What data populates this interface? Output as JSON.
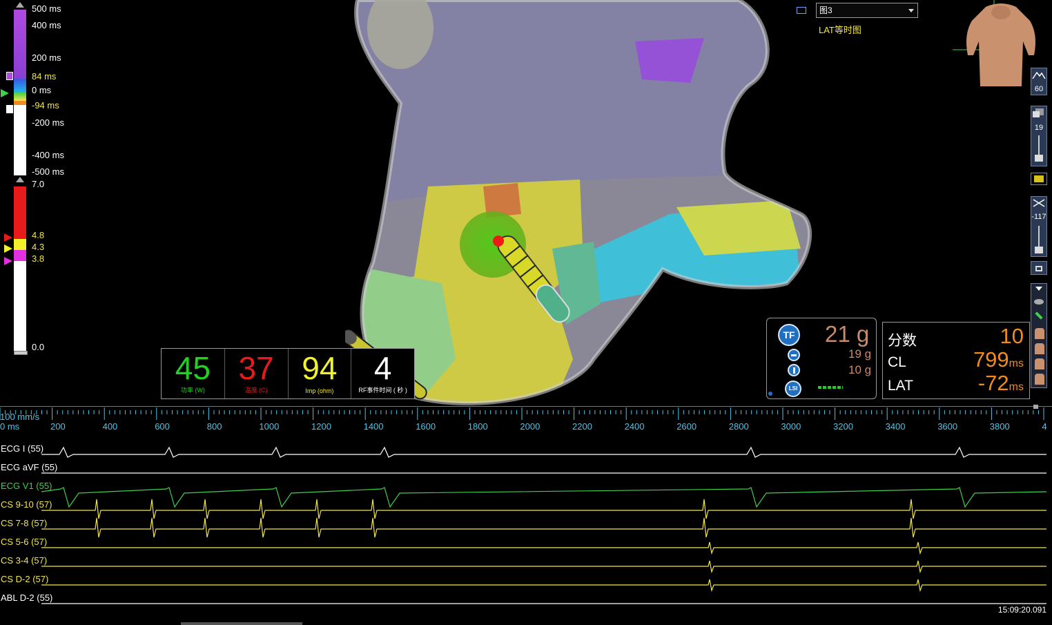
{
  "lat_scale": {
    "labels": [
      "500 ms",
      "400 ms",
      "200 ms",
      "84 ms",
      "0 ms",
      "-94 ms",
      "-200 ms",
      "-400 ms",
      "-500 ms"
    ]
  },
  "voltage_scale": {
    "labels": [
      "7.0",
      "4.8",
      "4.3",
      "3.8",
      "0.0"
    ]
  },
  "view": {
    "selected": "图3",
    "map_name": "LAT等时图"
  },
  "tools": {
    "zoom_value": "60",
    "opacity_value": "19",
    "clip_value": "-117"
  },
  "rf": {
    "power": {
      "value": "45",
      "label": "功率 (W)",
      "color": "#22d022"
    },
    "temperature": {
      "value": "37",
      "label": "温度 (C)",
      "color": "#e81a1a"
    },
    "impedance": {
      "value": "94",
      "label": "Imp (ohm)",
      "color": "#f2f22a"
    },
    "rf_time": {
      "value": "4",
      "label": "RF事件时间 ( 秒 )",
      "color": "#ffffff"
    }
  },
  "force": {
    "tf_badge": "TF",
    "lsi_badge": "LSI",
    "total": "21 g",
    "lateral": "19 g",
    "axial": "10 g"
  },
  "stats": {
    "score_label": "分数",
    "score_value": "10",
    "cl_label": "CL",
    "cl_value": "799",
    "cl_unit": "ms",
    "lat_label": "LAT",
    "lat_value": "-72",
    "lat_unit": "ms"
  },
  "timeline": {
    "speed": "100 mm/s",
    "start": "0 ms",
    "ticks": [
      "200",
      "400",
      "600",
      "800",
      "1000",
      "1200",
      "1400",
      "1600",
      "1800",
      "2000",
      "2200",
      "2400",
      "2600",
      "2800",
      "3000",
      "3200",
      "3400",
      "3600",
      "3800",
      "4"
    ]
  },
  "channels": [
    {
      "label": "ECG I (55)",
      "color": "#ffffff"
    },
    {
      "label": "ECG aVF (55)",
      "color": "#ffffff"
    },
    {
      "label": "ECG V1 (55)",
      "color": "#3fd04a"
    },
    {
      "label": "CS   9-10 (57)",
      "color": "#f2e64a"
    },
    {
      "label": "CS   7-8 (57)",
      "color": "#f2e64a"
    },
    {
      "label": "CS   5-6 (57)",
      "color": "#f2e64a"
    },
    {
      "label": "CS   3-4 (57)",
      "color": "#f2e64a"
    },
    {
      "label": "CS   D-2 (57)",
      "color": "#f2e64a"
    },
    {
      "label": "ABL   D-2 (55)",
      "color": "#ffffff"
    }
  ],
  "timestamp": "15:09:20.091"
}
